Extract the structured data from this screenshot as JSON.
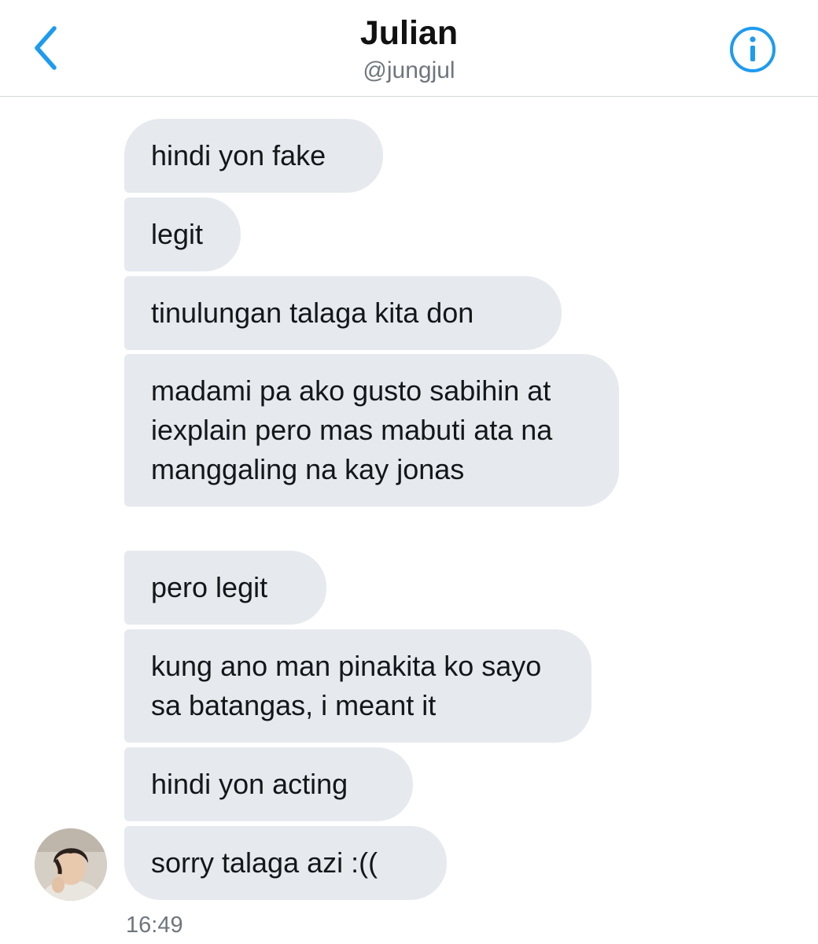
{
  "header": {
    "name": "Julian",
    "handle": "@jungjul",
    "back_icon": "chevron-left-icon",
    "info_icon": "info-circle-icon",
    "accent_color": "#1d9bf0"
  },
  "messages": [
    {
      "text": "hindi yon fake"
    },
    {
      "text": "legit"
    },
    {
      "text": "tinulungan talaga kita don"
    },
    {
      "text": "madami pa ako gusto sabihin at iexplain pero mas mabuti ata na manggaling na kay jonas"
    },
    {
      "text": "pero legit"
    },
    {
      "text": "kung ano man pinakita ko sayo sa batangas, i meant it"
    },
    {
      "text": "hindi yon acting"
    },
    {
      "text": "sorry talaga azi :(("
    }
  ],
  "timestamp": "16:49",
  "bubble_color": "#e6e9ee"
}
